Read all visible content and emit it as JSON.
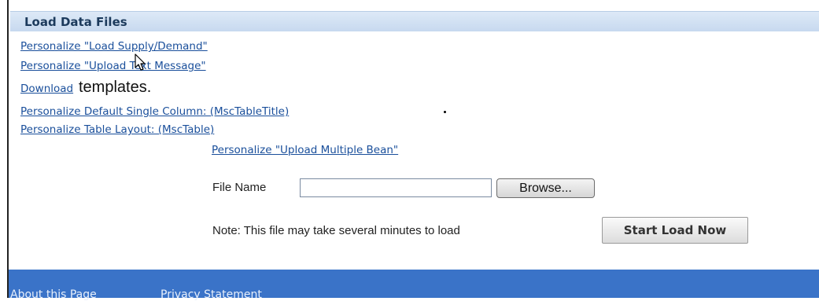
{
  "section": {
    "title": "Load Data Files"
  },
  "links": {
    "load_supply_demand": "Personalize \"Load Supply/Demand\"",
    "upload_text_message": "Personalize \"Upload Text Message\"",
    "download": "Download",
    "download_suffix": "templates.",
    "default_single_column": "Personalize Default Single Column: (MscTableTitle)",
    "table_layout": "Personalize Table Layout: (MscTable)",
    "upload_multiple_bean": "Personalize \"Upload Multiple Bean\""
  },
  "form": {
    "file_name_label": "File Name",
    "file_name_value": "",
    "browse_label": "Browse...",
    "note": "Note: This file may take several minutes to load",
    "start_label": "Start Load Now"
  },
  "footer": {
    "about": "About this Page",
    "privacy": "Privacy Statement"
  },
  "colors": {
    "link": "#1a4f9b",
    "header_bg": "#c7d9ef",
    "footer_bg": "#3a73c8"
  },
  "icons": {
    "cursor": "mouse-pointer-icon"
  }
}
